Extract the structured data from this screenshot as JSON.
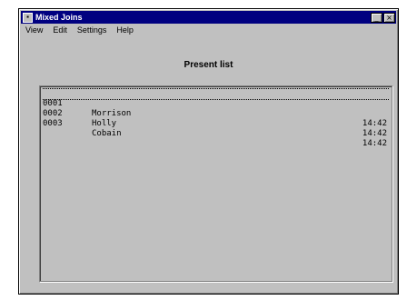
{
  "window": {
    "title": "Mixed Joins",
    "icon": "app-icon",
    "buttons": [
      "minimize-icon",
      "close-icon"
    ]
  },
  "menu": [
    {
      "label": "View"
    },
    {
      "label": "Edit"
    },
    {
      "label": "Settings"
    },
    {
      "label": "Help"
    }
  ],
  "main": {
    "heading": "Present list",
    "list": [
      {
        "id": "0001",
        "name": "Morrison",
        "time": "14:42"
      },
      {
        "id": "0002",
        "name": "Holly",
        "time": "14:42"
      },
      {
        "id": "0003",
        "name": "Cobain",
        "time": "14:42"
      }
    ]
  }
}
